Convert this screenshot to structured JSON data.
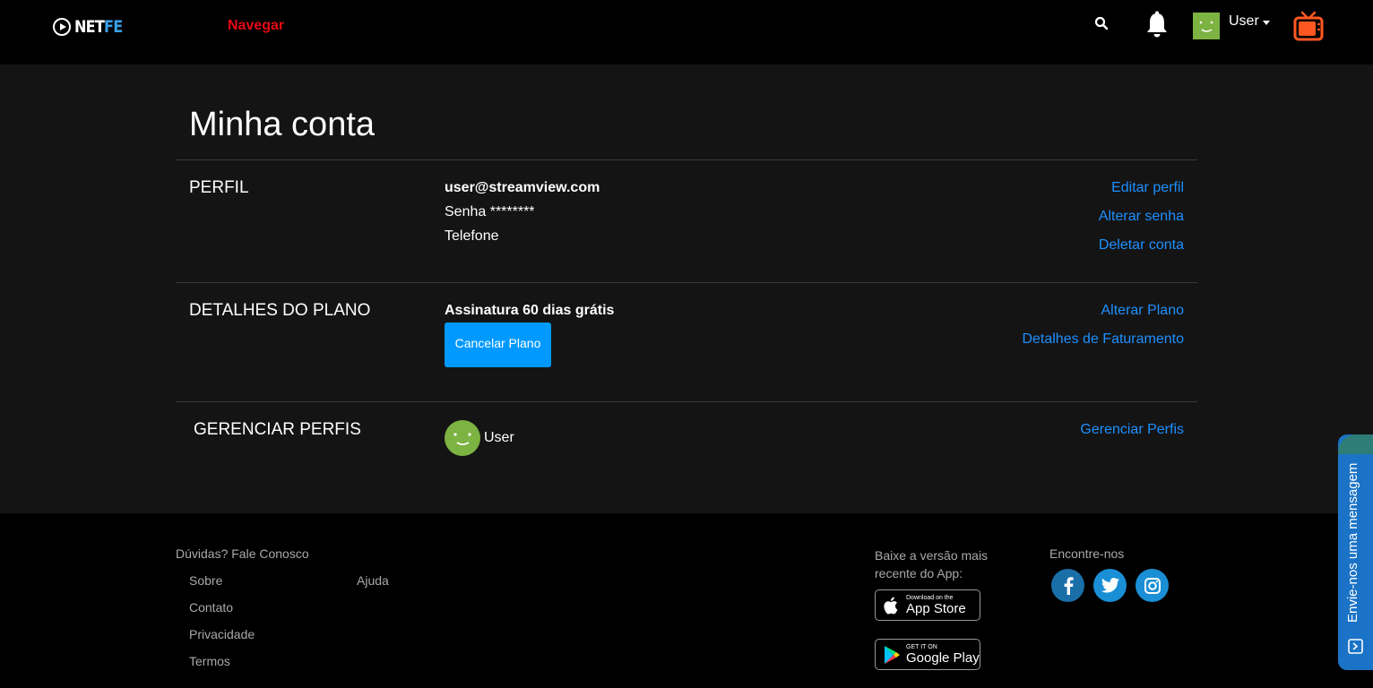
{
  "header": {
    "logo_text_a": "NET",
    "logo_text_b": "FE",
    "nav_label": "Navegar",
    "user_name": "User"
  },
  "page": {
    "title": "Minha conta"
  },
  "profile_section": {
    "label": "PERFIL",
    "email": "user@streamview.com",
    "password": "Senha ********",
    "phone": "Telefone",
    "links": [
      "Editar perfil",
      "Alterar senha",
      "Deletar conta"
    ]
  },
  "plan_section": {
    "label": "DETALHES DO PLANO",
    "plan_name": "Assinatura 60 dias grátis",
    "cancel_button": "Cancelar Plano",
    "links": [
      "Alterar Plano",
      "Detalhes de Faturamento"
    ]
  },
  "manage_section": {
    "label": "GERENCIAR PERFIS",
    "profile_name": "User",
    "link": "Gerenciar Perfis"
  },
  "footer": {
    "contact": "Dúvidas? Fale Conosco",
    "links_col1": [
      "Sobre",
      "Contato",
      "Privacidade",
      "Termos"
    ],
    "links_col2": [
      "Ajuda"
    ],
    "app_text": "Baixe a versão mais recente do App:",
    "app_store": {
      "small": "Download on the",
      "big": "App Store"
    },
    "google_play": {
      "small": "GET IT ON",
      "big": "Google Play"
    },
    "find_us": "Encontre-nos",
    "social_icons": [
      "facebook-icon",
      "twitter-icon",
      "instagram-icon"
    ]
  },
  "chat": {
    "label": "Envie-nos uma mensagem"
  },
  "colors": {
    "accent_red": "#e50914",
    "link_blue": "#1e90ff",
    "button_blue": "#0099ff",
    "avatar_green": "#7cb342",
    "tv_orange": "#ff5722",
    "social_blue": "#1a6fa8"
  }
}
